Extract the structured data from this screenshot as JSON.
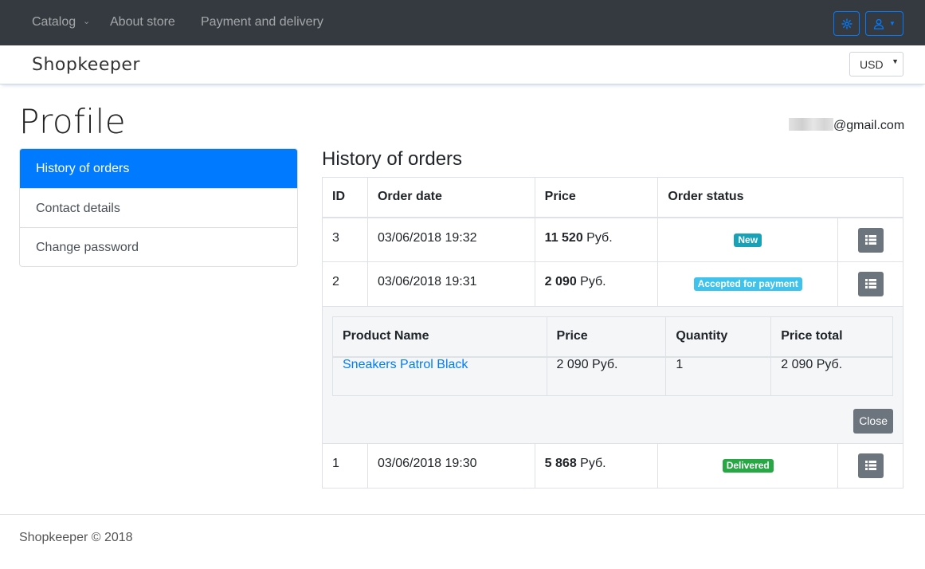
{
  "nav": {
    "catalog": "Catalog",
    "about": "About store",
    "payment": "Payment and delivery",
    "settings_icon": "gear-icon",
    "user_icon": "user-icon"
  },
  "brand": {
    "name": "Shopkeeper",
    "currency": "USD"
  },
  "page": {
    "title": "Profile",
    "email_suffix": "@gmail.com"
  },
  "sidebar": {
    "items": [
      {
        "label": "History of orders"
      },
      {
        "label": "Contact details"
      },
      {
        "label": "Change password"
      }
    ]
  },
  "orders": {
    "title": "History of orders",
    "columns": [
      "ID",
      "Order date",
      "Price",
      "Order status"
    ],
    "rows": [
      {
        "id": "3",
        "date": "03/06/2018 19:32",
        "price": "11 520",
        "currency": " Руб.",
        "status": "New"
      },
      {
        "id": "2",
        "date": "03/06/2018 19:31",
        "price": "2 090",
        "currency": " Руб.",
        "status": "Accepted for payment"
      },
      {
        "id": "1",
        "date": "03/06/2018 19:30",
        "price": "5 868",
        "currency": " Руб.",
        "status": "Delivered"
      }
    ],
    "details": {
      "columns": [
        "Product Name",
        "Price",
        "Quantity",
        "Price total"
      ],
      "rows": [
        {
          "name": "Sneakers Patrol Black",
          "price": "2 090 Руб.",
          "quantity": "1",
          "total": "2 090 Руб."
        }
      ],
      "close_label": "Close"
    }
  },
  "colors": {
    "primary": "#007bff",
    "dark": "#343a40",
    "secondary": "#6c757d",
    "badge_new": "#17a2b8",
    "badge_accepted": "#3fc2ec",
    "badge_delivered": "#28a745"
  },
  "footer": {
    "text": "Shopkeeper © 2018"
  }
}
